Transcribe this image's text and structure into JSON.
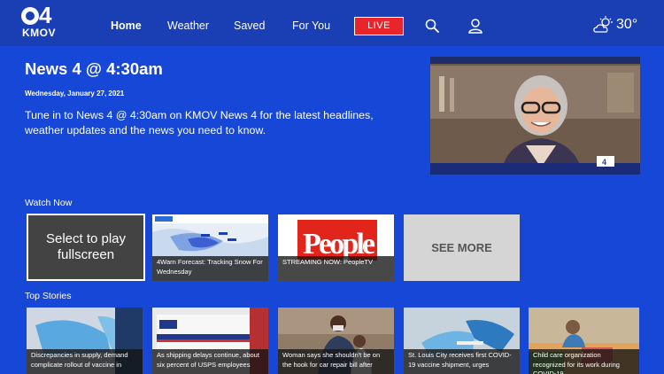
{
  "brand": {
    "channel_number": "4",
    "call_sign": "KMOV"
  },
  "nav": {
    "items": [
      {
        "label": "Home",
        "active": true
      },
      {
        "label": "Weather",
        "active": false
      },
      {
        "label": "Saved",
        "active": false
      },
      {
        "label": "For You",
        "active": false
      }
    ],
    "live_label": "LIVE",
    "search_icon": "search-icon",
    "account_icon": "user-icon"
  },
  "weather": {
    "icon": "partly-cloudy-sun-icon",
    "temperature": "30°"
  },
  "hero": {
    "title": "News 4 @ 4:30am",
    "date": "Wednesday, January 27, 2021",
    "description": "Tune in to News 4 @ 4:30am on KMOV News 4 for the latest headlines, weather updates and the news you need to know."
  },
  "watch_now": {
    "label": "Watch Now",
    "focus_text": "Select to play fullscreen",
    "items": [
      {
        "caption": ""
      },
      {
        "caption": "4Warn Forecast: Tracking Snow For Wednesday"
      },
      {
        "caption": "STREAMING NOW: PeopleTV"
      },
      {
        "caption": "SEE MORE"
      }
    ]
  },
  "top_stories": {
    "label": "Top Stories",
    "items": [
      {
        "caption": "Discrepancies in supply, demand complicate rollout of vaccine in"
      },
      {
        "caption": "As shipping delays continue, about six percent of USPS employees"
      },
      {
        "caption": "Woman says she shouldn't be on the hook for car repair bill after"
      },
      {
        "caption": "St. Louis City receives first COVID-19 vaccine shipment, urges"
      },
      {
        "caption": "Child care organization recognized for its work during COVID-19"
      }
    ]
  },
  "colors": {
    "background": "#1747d6",
    "topbar": "#1a3fb4",
    "live": "#e8252b"
  }
}
